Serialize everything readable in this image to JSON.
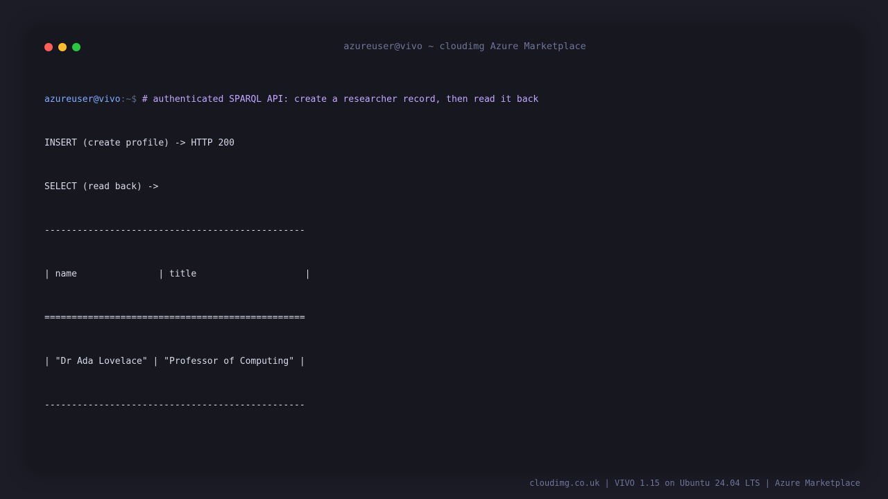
{
  "window": {
    "title": "azureuser@vivo ~ cloudimg Azure Marketplace"
  },
  "terminal": {
    "prompt_user": "azureuser@vivo",
    "prompt_path": ":~$ ",
    "command": "# authenticated SPARQL API: create a researcher record, then read it back",
    "output": [
      "INSERT (create profile) -> HTTP 200",
      "SELECT (read back) ->",
      "------------------------------------------------",
      "| name               | title                    |",
      "================================================",
      "| \"Dr Ada Lovelace\" | \"Professor of Computing\" |",
      "------------------------------------------------"
    ]
  },
  "status_bar": {
    "text": "cloudimg.co.uk | VIVO 1.15 on Ubuntu 24.04 LTS | Azure Marketplace"
  },
  "colors": {
    "page_background": "#1b1c26",
    "terminal_background": "#16171f",
    "prompt_user": "#82aaff",
    "command": "#c3a6ff",
    "output_text": "#d6d9e8",
    "muted": "#6e7599",
    "close": "#ff5f57",
    "minimize": "#febc2e",
    "maximize": "#28c840"
  }
}
